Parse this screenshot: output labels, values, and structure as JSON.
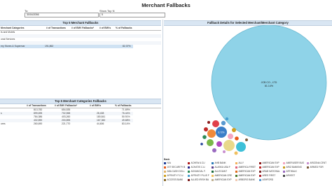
{
  "title": "Merchant Fallbacks",
  "filters": {
    "to_label": "To:",
    "to_value": "30/04/2056",
    "show_top_label": "Show Top N",
    "show_top_value": "5"
  },
  "top_merchant": {
    "title": "Top 5 Merchant Fallbacks",
    "columns": [
      "Merchant Categories",
      "# of Transactions",
      "# of EMV Fallbacks*",
      "# of EMVs",
      "% of Fallbacks"
    ],
    "rows": [
      [
        "ts and Motels",
        "",
        "",
        "",
        ""
      ],
      [
        "",
        "",
        "",
        "",
        ""
      ],
      [
        "onal Services",
        "",
        "",
        "",
        ""
      ],
      [
        "",
        "",
        "",
        "",
        ""
      ],
      [
        "ery Stores & Supermar",
        "191,862",
        "",
        "",
        "82.37%"
      ]
    ]
  },
  "top_categories": {
    "title": "Top 5 Merchant Categories Fallbacks",
    "columns": [
      "# of Transactions",
      "# of EMV Fallbacks*",
      "# of EMVs",
      "% of Fallbacks"
    ],
    "rows": [
      [
        "",
        "813,782",
        "654,535",
        "",
        "71.69%"
      ],
      [
        "s",
        "899,695",
        "702,558",
        "28,408",
        "76.44%"
      ],
      [
        "",
        "784,386",
        "403,260",
        "180,841",
        "50.91%"
      ],
      [
        "",
        "402,890",
        "200,895",
        "167,360",
        "49.68%"
      ],
      [
        "ores",
        "260,690",
        "221,770",
        "44,606",
        "83.14%"
      ]
    ]
  },
  "bubble_panel": {
    "title": "Fallback Details for Selected Merchant/Merchant Category",
    "big_label": "JCB CO., LTD",
    "big_value": "81.14%",
    "mid_label": "8.72%"
  },
  "legend": {
    "title": "Bank",
    "items": [
      {
        "label": "N/A",
        "color": "#1f3f99"
      },
      {
        "label": "ACHEW A CU",
        "color": "#b01c1c"
      },
      {
        "label": "AHB BANK",
        "color": "#2a7ab8"
      },
      {
        "label": "ALLY",
        "color": "#f3b25a"
      },
      {
        "label": "AMERICAN EXP",
        "color": "#8b1a1a"
      },
      {
        "label": "AMERUSER BUS",
        "color": "#f4a6c1"
      },
      {
        "label": "ARIZONA CENT",
        "color": "#c98fd0"
      },
      {
        "label": "1ST SECURITY B",
        "color": "#e85a1a"
      },
      {
        "label": "ACHATIS C.U.",
        "color": "#2a2a8a"
      },
      {
        "label": "ALASKA USA F",
        "color": "#5a3f8a"
      },
      {
        "label": "AMERICA FIRST",
        "color": "#e0607a"
      },
      {
        "label": "AMERICAN EXP",
        "color": "#c02a2a"
      },
      {
        "label": "ARIZ BANKING",
        "color": "#c99b20"
      },
      {
        "label": "ARMED FOR",
        "color": "#7a5a3a"
      },
      {
        "label": "ABA CASH DOLL",
        "color": "#e2b36a"
      },
      {
        "label": "ADVANCIAL F.",
        "color": "#2e8b57"
      },
      {
        "label": "ALLEGIANT",
        "color": "#1a6a3a"
      },
      {
        "label": "AMERICAN EXP",
        "color": "#e06a1a"
      },
      {
        "label": "ARAB NATIONAL",
        "color": "#7a2a2a"
      },
      {
        "label": "ARTWALK",
        "color": "#9a6ac0"
      },
      {
        "label": "AFFINITY F.C.U.",
        "color": "#d0a020"
      },
      {
        "label": "AFFINITY PLUS F",
        "color": "#4aa0d0"
      },
      {
        "label": "AMERICAN CRE",
        "color": "#f0c060"
      },
      {
        "label": "AMERICAN EXP",
        "color": "#4a7a2a"
      },
      {
        "label": "ARES FIRST",
        "color": "#b0202a"
      },
      {
        "label": "ARVEST",
        "color": "#4a4a4a"
      },
      {
        "label": "ACCESS BANK",
        "color": "#8a6a2a"
      },
      {
        "label": "ALLIED IRISH BA",
        "color": "#7a1a1a"
      },
      {
        "label": "AMERICAN EXP",
        "color": "#c0b090"
      },
      {
        "label": "ARBORG BANK",
        "color": "#f0c8b0"
      },
      {
        "label": "ASHFORD",
        "color": "#5a9ad0"
      }
    ]
  },
  "chart_data": {
    "type": "bubble",
    "title": "Fallback Details for Selected Merchant/Merchant Category",
    "series": [
      {
        "name": "JCB CO., LTD",
        "value": 81.14
      },
      {
        "name": "N/A",
        "value": 8.72
      }
    ]
  }
}
